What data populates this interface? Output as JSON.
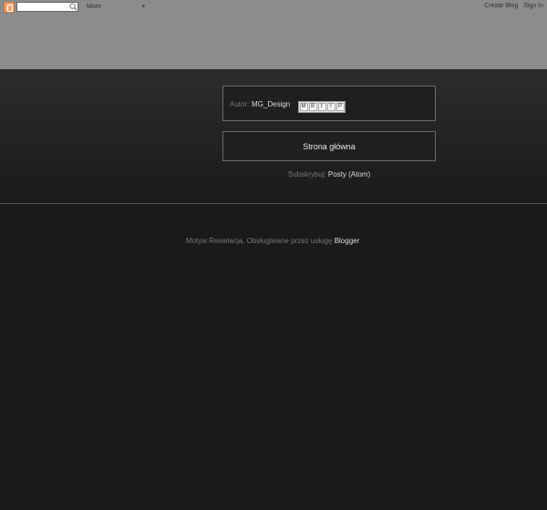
{
  "navbar": {
    "more_label": "More",
    "create_blog": "Create Blog",
    "sign_in": "Sign In"
  },
  "post_footer": {
    "author_label": "Autor:",
    "author_name": "MG_Design",
    "share_icons": [
      "email-icon",
      "blogthis-icon",
      "twitter-icon",
      "facebook-icon",
      "pinterest-icon"
    ]
  },
  "home_link": "Strona główna",
  "subscribe": {
    "label": "Subskrybuj:",
    "link": "Posty (Atom)"
  },
  "attribution": {
    "text": "Motyw Rewelacja. Obsługiwane przez usługę",
    "link": "Blogger",
    "period": "."
  },
  "colors": {
    "navbar_bg": "#8c8c8c",
    "page_bg": "#1a1a1a",
    "link_text": "#dddddd",
    "muted_text": "#777777"
  }
}
